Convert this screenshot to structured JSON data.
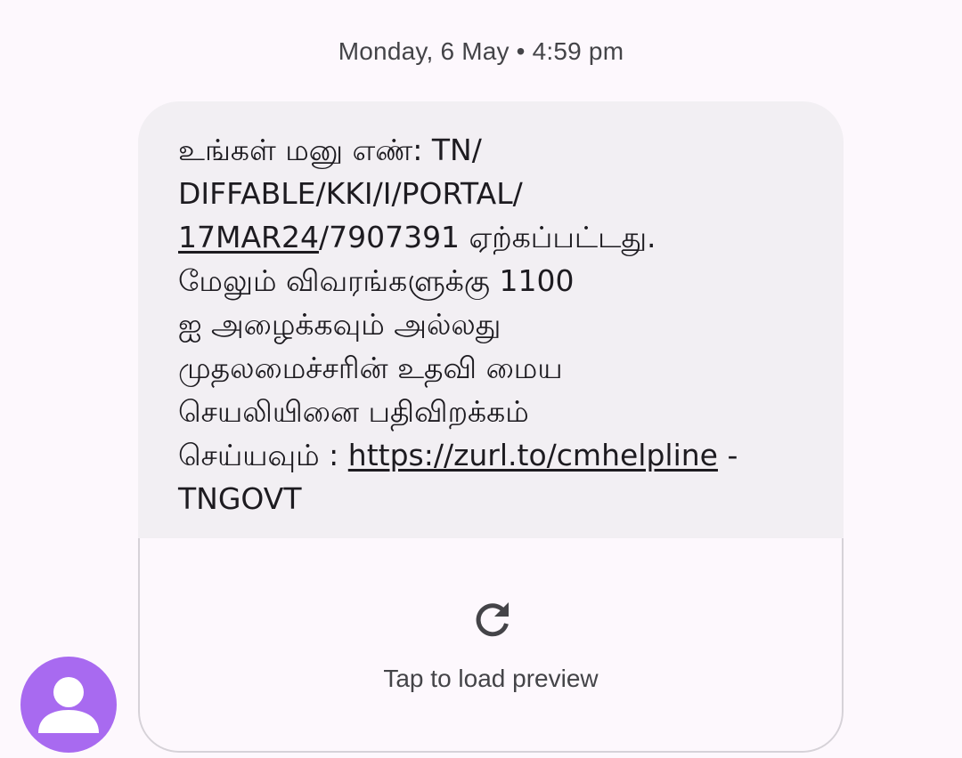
{
  "timestamp": "Monday, 6 May • 4:59 pm",
  "message": {
    "line1": "உங்கள் மனு எண்: TN/",
    "line2": "DIFFABLE/KKI/I/PORTAL/",
    "line3_link": "17MAR24",
    "line3_rest": "/7907391 ஏற்கப்பட்டது.",
    "line4": "மேலும் விவரங்களுக்கு 1100",
    "line5": "ஐ அழைக்கவும் அல்லது",
    "line6": "முதலமைச்சரின் உதவி மைய",
    "line7": "செயலியினை பதிவிறக்கம்",
    "line8_prefix": "செய்யவும் : ",
    "line8_link": "https://zurl.to/cmhelpline",
    "line8_suffix": " -",
    "line9": "TNGOVT"
  },
  "preview": {
    "label": "Tap to load preview",
    "icon": "refresh-icon"
  },
  "avatar": {
    "icon": "person-icon",
    "color": "#a86af0"
  },
  "colors": {
    "background": "#fdf8fd",
    "bubble": "#f2eff3",
    "text": "#1d1b20",
    "secondary_text": "#444448",
    "border": "#d6d2d8"
  }
}
